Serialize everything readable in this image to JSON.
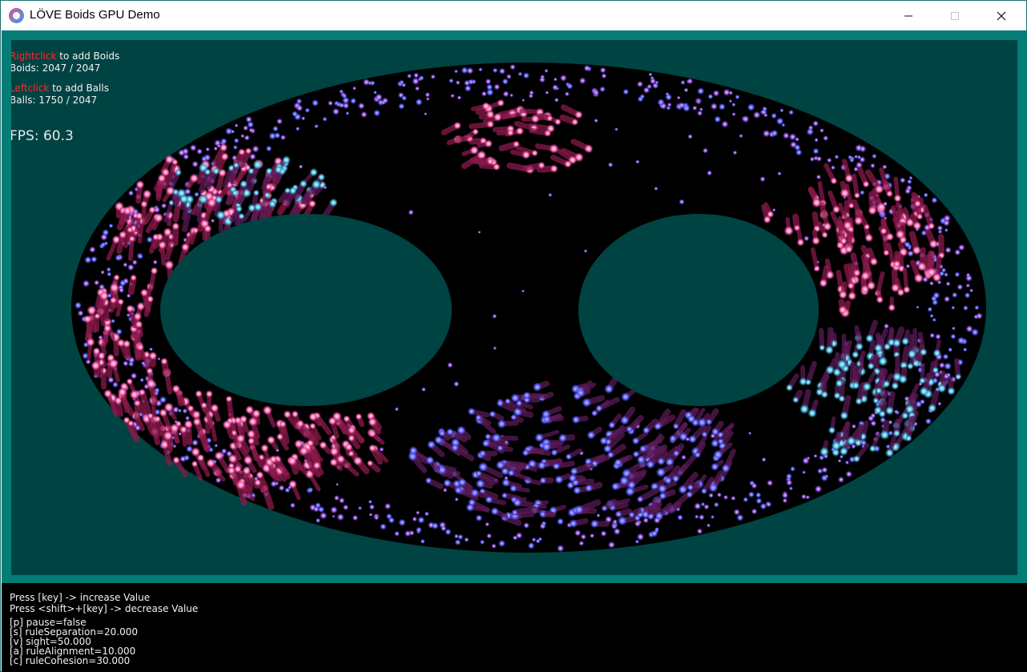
{
  "window": {
    "title": "LÖVE Boids GPU Demo",
    "icon": "love-heart-icon",
    "controls": [
      "minimize-icon",
      "maximize-icon",
      "close-icon"
    ]
  },
  "hud": {
    "boids_action": "Rightclick",
    "boids_action_rest": " to add Boids",
    "boids_count": "Boids: 2047 / 2047",
    "balls_action": "Leftclick",
    "balls_action_rest": " to add Balls",
    "balls_count": "Balls: 1750 / 2047",
    "fps": "FPS: 60.3"
  },
  "console": {
    "help1": "Press [key] -> increase Value",
    "help2": "Press <shift>+[key] -> decrease Value",
    "params": [
      "[p] pause=false",
      "[s] ruleSeparation=20.000",
      "[v] sight=50.000",
      "[a] ruleAlignment=10.000",
      "[c] ruleCohesion=30.000"
    ]
  },
  "colors": {
    "frame": "#067c77",
    "background": "#004343",
    "arena": "#000000",
    "hint_red": "#ff2a2a",
    "boid_pink": "#e35aa8",
    "ball_blue": "#6a6cff"
  }
}
